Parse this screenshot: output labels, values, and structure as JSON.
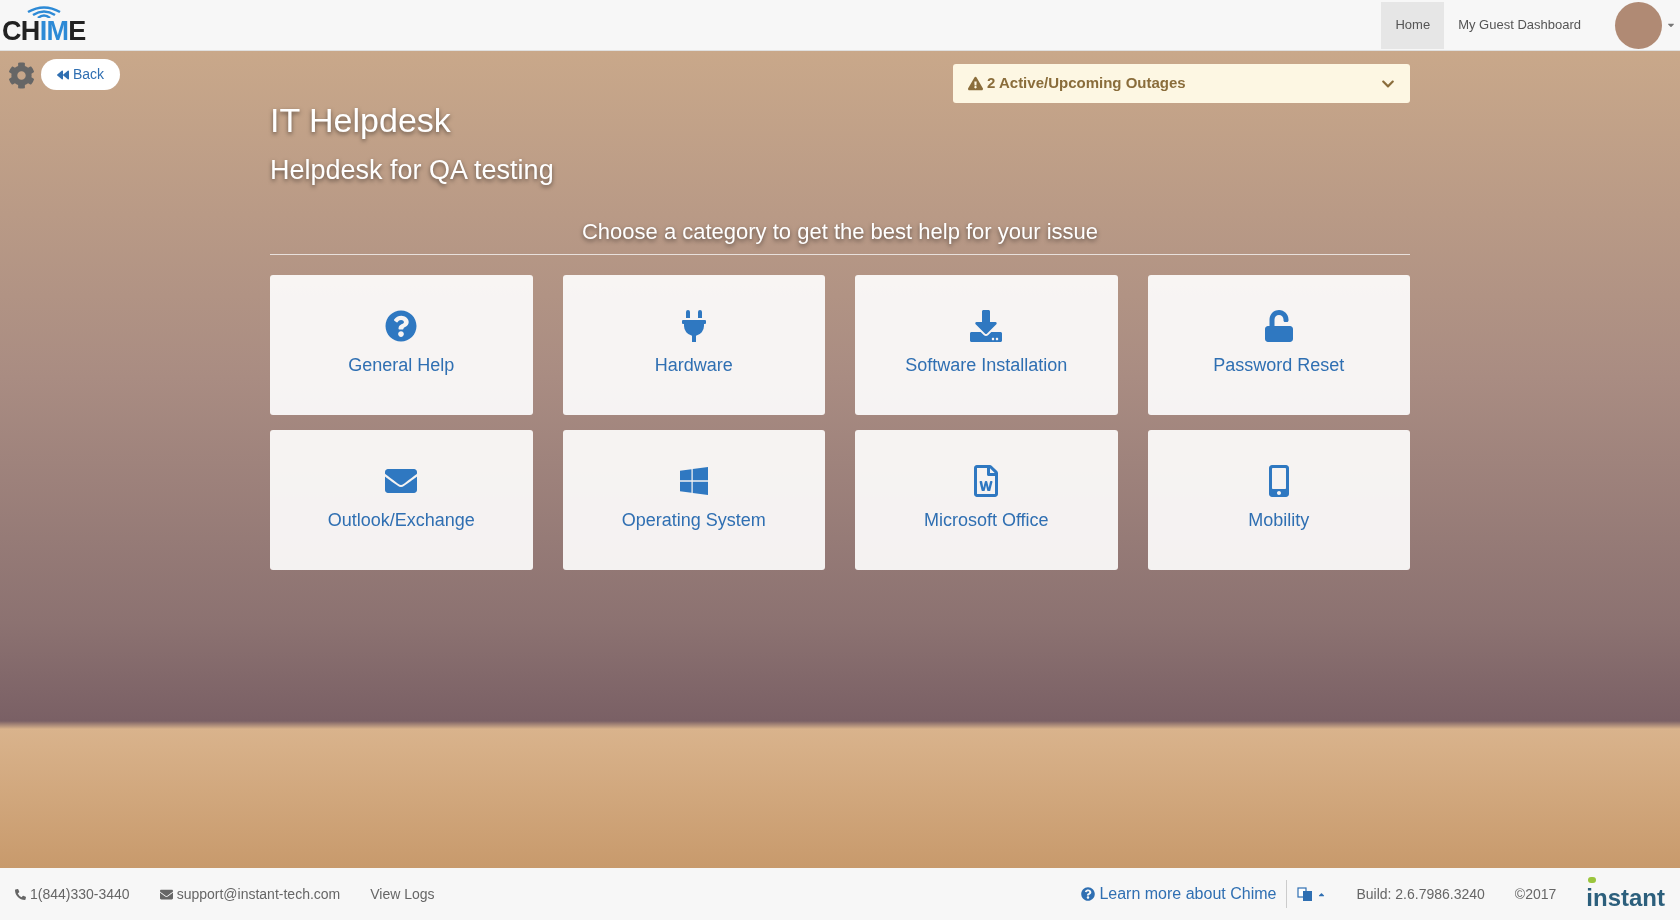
{
  "header": {
    "logo_parts": [
      {
        "text": "CH",
        "highlighted": false
      },
      {
        "text": "IM",
        "highlighted": true
      },
      {
        "text": "E",
        "highlighted": false
      }
    ],
    "nav": [
      {
        "label": "Home",
        "selected": true
      },
      {
        "label": "My Guest Dashboard",
        "selected": false
      }
    ]
  },
  "toolbar": {
    "back": "Back"
  },
  "outages": {
    "label": "2 Active/Upcoming Outages",
    "expanded": false
  },
  "title": "IT Helpdesk",
  "subtitle": "Helpdesk for QA testing",
  "prompt": "Choose a category to get the best help for your issue",
  "categories": [
    {
      "label": "General Help"
    },
    {
      "label": "Hardware"
    },
    {
      "label": "Software Installation"
    },
    {
      "label": "Password Reset"
    },
    {
      "label": "Outlook/Exchange"
    },
    {
      "label": "Operating System"
    },
    {
      "label": "Microsoft Office"
    },
    {
      "label": "Mobility"
    }
  ],
  "footer": {
    "phone": "1(844)330-3440",
    "email": "support@instant-tech.com",
    "logs": "View Logs",
    "learn": "Learn more about Chime",
    "build": "Build: 2.6.7986.3240",
    "copyright": "©2017",
    "brand": "instant"
  }
}
